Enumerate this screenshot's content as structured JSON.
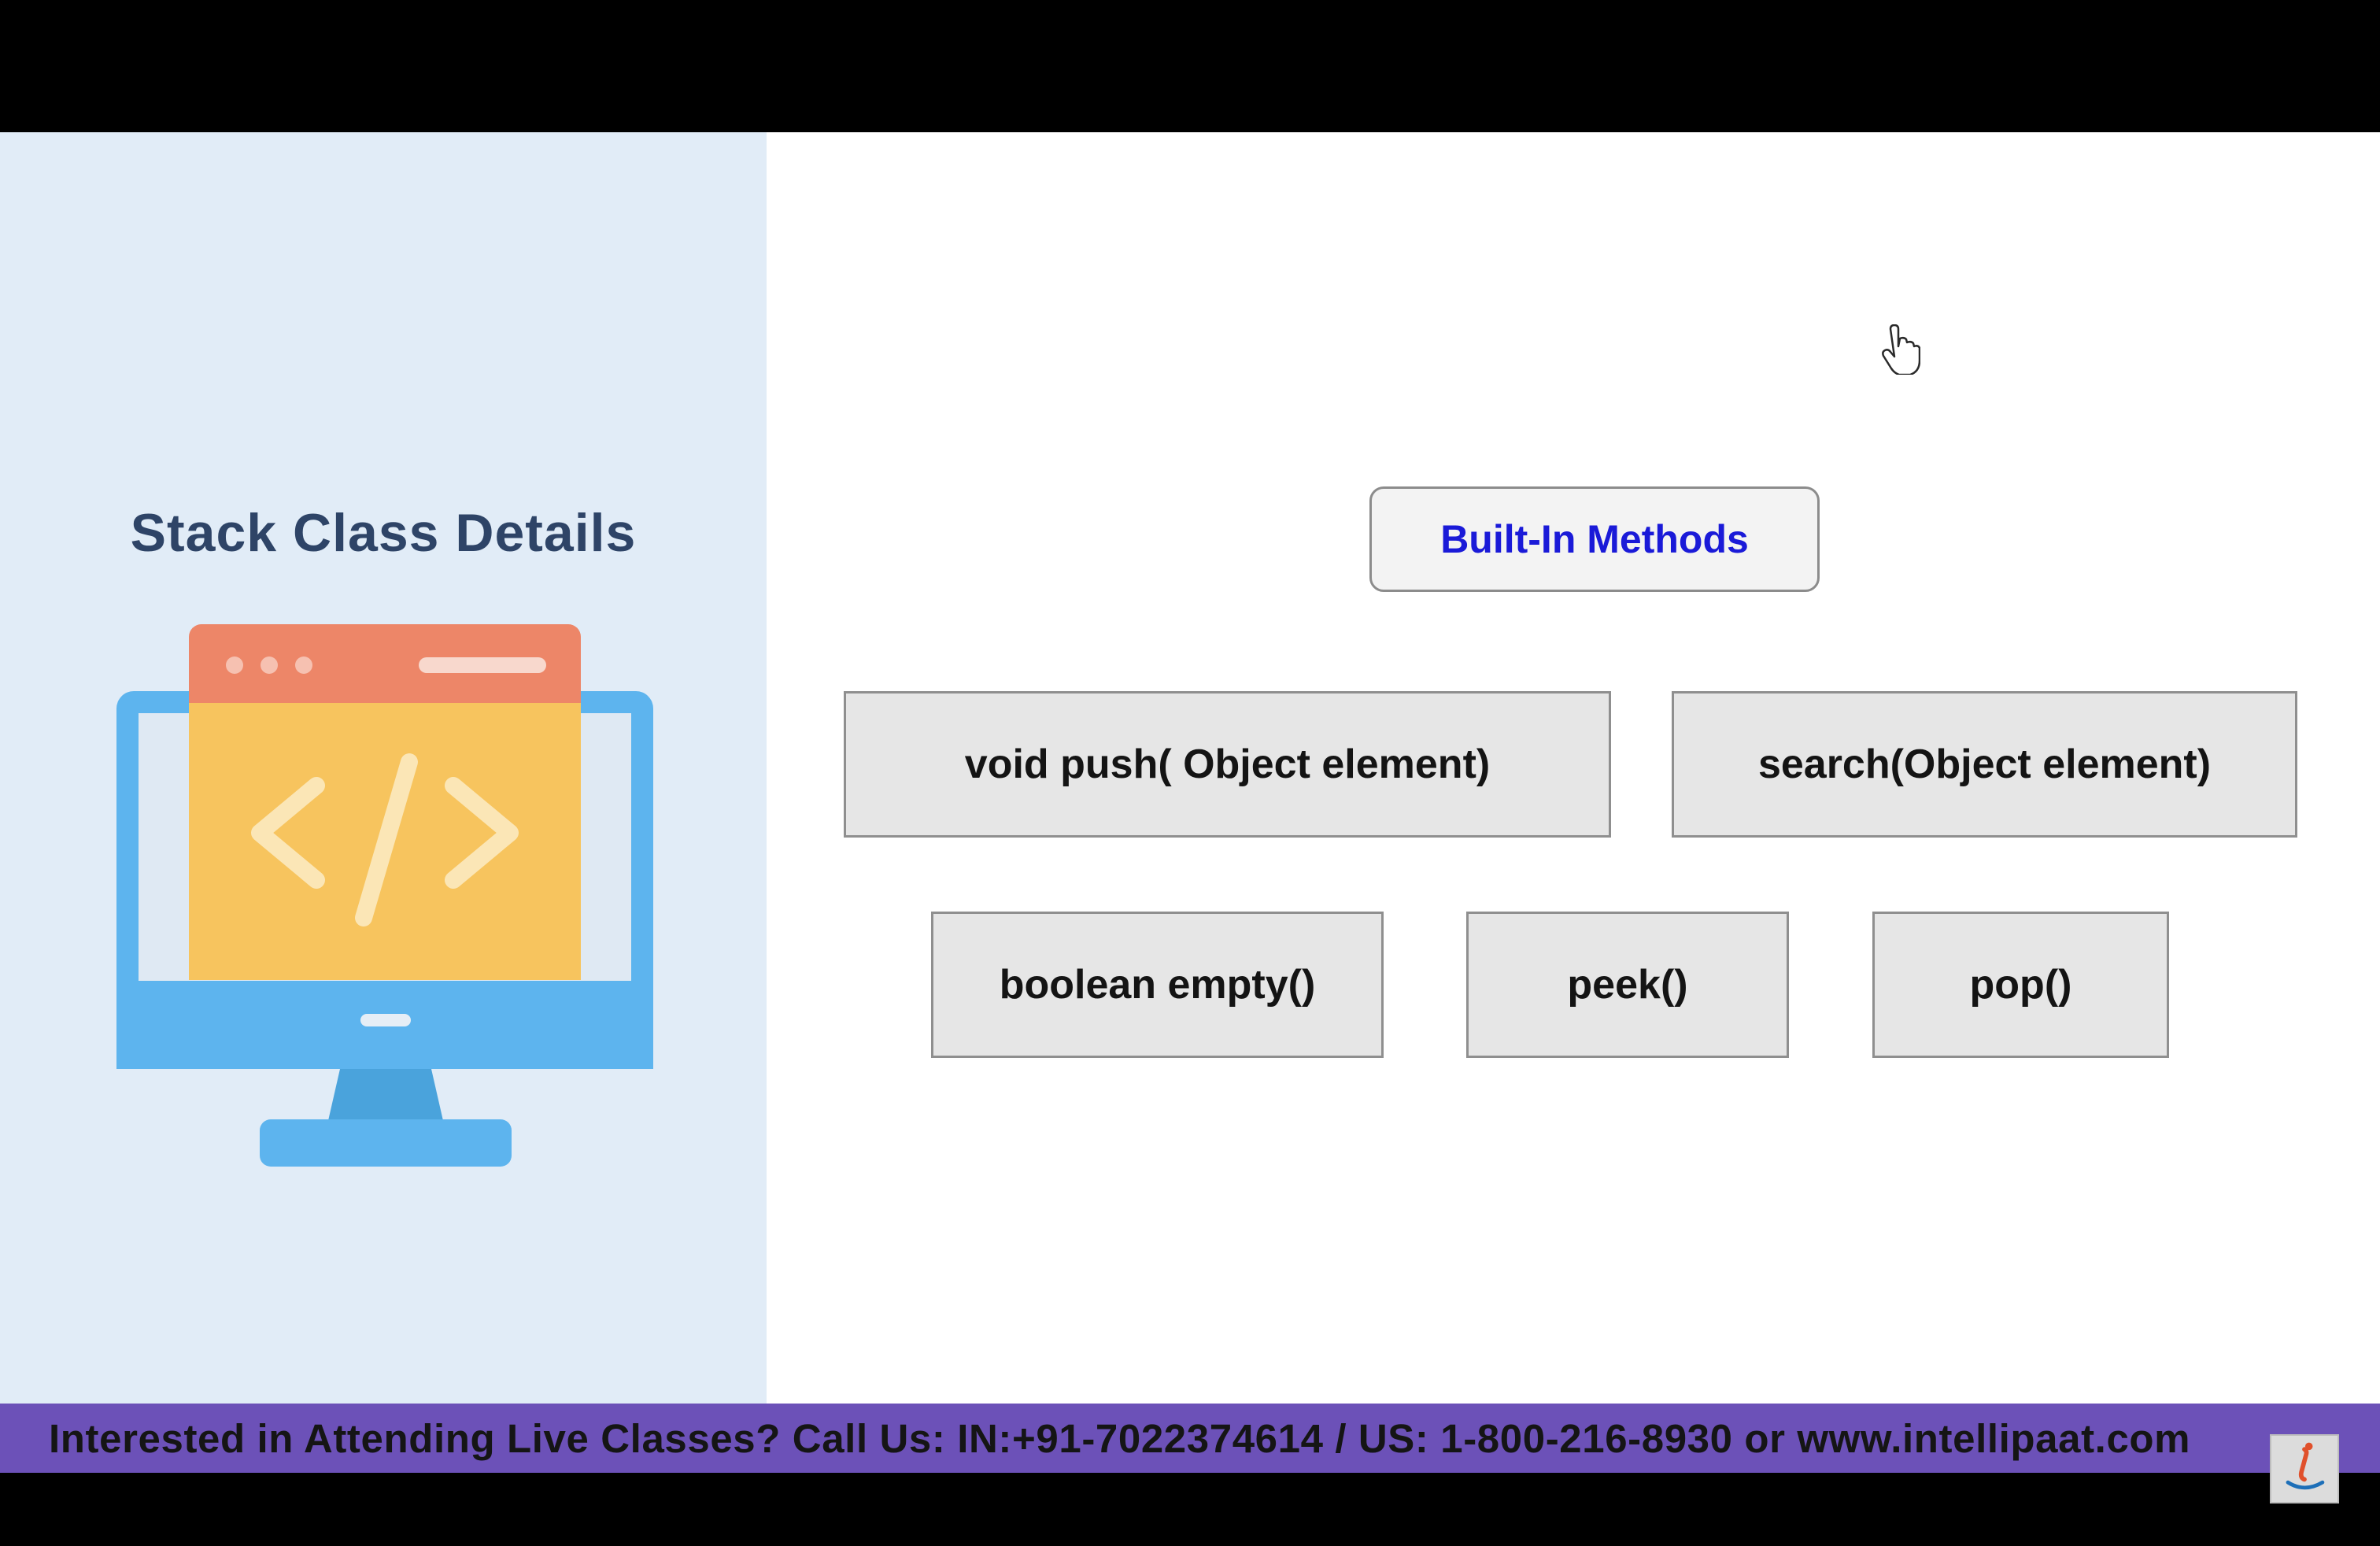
{
  "slide": {
    "title": "Stack Class Details",
    "center_title": "Built-In Methods",
    "methods": [
      "void push( Object element)",
      "search(Object element)",
      "boolean empty()",
      "peek()",
      "pop()"
    ]
  },
  "banner": {
    "text": "Interested in Attending Live Classes? Call Us: IN:+91-7022374614 / US: 1-800-216-8930 or www.intellipaat.com"
  },
  "icons": {
    "illustration": "monitor-code-icon",
    "cursor": "hand-pointer-icon",
    "logo": "intellipaat-logo-icon"
  },
  "colors": {
    "left_panel": "#e1ecf7",
    "title": "#2e4467",
    "center_title_text": "#1a1ad8",
    "method_box": "#e6e6e6",
    "banner": "#6c51b8"
  }
}
